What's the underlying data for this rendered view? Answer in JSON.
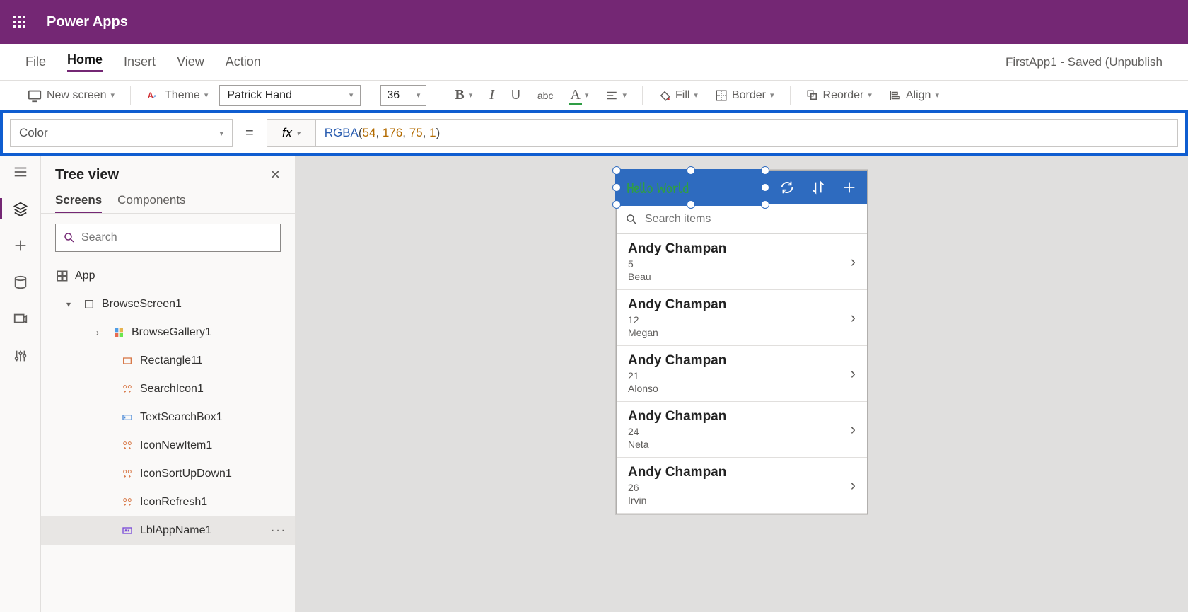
{
  "app_title": "Power Apps",
  "menubar": {
    "items": [
      "File",
      "Home",
      "Insert",
      "View",
      "Action"
    ],
    "active": "Home",
    "status": "FirstApp1 - Saved (Unpublish"
  },
  "toolbar": {
    "new_screen": "New screen",
    "theme": "Theme",
    "font": "Patrick Hand",
    "size": "36",
    "fill": "Fill",
    "border": "Border",
    "reorder": "Reorder",
    "align": "Align"
  },
  "formula": {
    "property": "Color",
    "fx": "fx",
    "fn": "RGBA",
    "args": [
      "54",
      "176",
      "75",
      "1"
    ]
  },
  "tree": {
    "title": "Tree view",
    "tabs": [
      "Screens",
      "Components"
    ],
    "active_tab": "Screens",
    "search_placeholder": "Search",
    "app_label": "App",
    "screen": {
      "name": "BrowseScreen1",
      "gallery": "BrowseGallery1",
      "children": [
        "Rectangle11",
        "SearchIcon1",
        "TextSearchBox1",
        "IconNewItem1",
        "IconSortUpDown1",
        "IconRefresh1",
        "LblAppName1"
      ],
      "selected": "LblAppName1"
    }
  },
  "preview": {
    "header_title": "Hello World",
    "search_placeholder": "Search items",
    "items": [
      {
        "name": "Andy Champan",
        "num": "5",
        "sub": "Beau"
      },
      {
        "name": "Andy Champan",
        "num": "12",
        "sub": "Megan"
      },
      {
        "name": "Andy Champan",
        "num": "21",
        "sub": "Alonso"
      },
      {
        "name": "Andy Champan",
        "num": "24",
        "sub": "Neta"
      },
      {
        "name": "Andy Champan",
        "num": "26",
        "sub": "Irvin"
      }
    ]
  }
}
